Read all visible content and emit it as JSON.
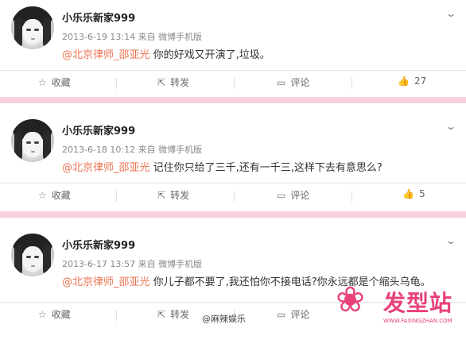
{
  "posts": [
    {
      "user": "小乐乐新家999",
      "meta": "2013-6-19 13:14 来自 微博手机版",
      "mention": "@北京律师_邵亚光",
      "text": " 你的好戏又开演了,垃圾。",
      "actions": {
        "favorite": "收藏",
        "repost": "转发",
        "comment": "评论",
        "likes": "27"
      }
    },
    {
      "user": "小乐乐新家999",
      "meta": "2013-6-18 10:12 来自 微博手机版",
      "mention": "@北京律师_邵亚光",
      "text": " 记住你只给了三千,还有一千三,这样下去有意思么?",
      "actions": {
        "favorite": "收藏",
        "repost": "转发",
        "comment": "评论",
        "likes": "5"
      }
    },
    {
      "user": "小乐乐新家999",
      "meta": "2013-6-17 13:57 来自 微博手机版",
      "mention": "@北京律师_邵亚光",
      "text": " 你儿子都不要了,我还怕你不接电话?你永远都是个缩头乌龟。",
      "actions": {
        "favorite": "收藏",
        "repost": "转发",
        "comment": "评论"
      }
    }
  ],
  "watermark": "@麻辣娱乐",
  "logo": {
    "brand": "发型站",
    "url": "WWW.FAXINGZHAN.COM"
  },
  "colors": {
    "mention": "#eb7350",
    "divider": "#f7d2dd",
    "logo": "#e8417a"
  },
  "icons": [
    "avatar",
    "chevron-down-icon",
    "star-icon",
    "share-icon",
    "comment-icon",
    "thumbs-up-icon",
    "flower-logo-icon"
  ]
}
